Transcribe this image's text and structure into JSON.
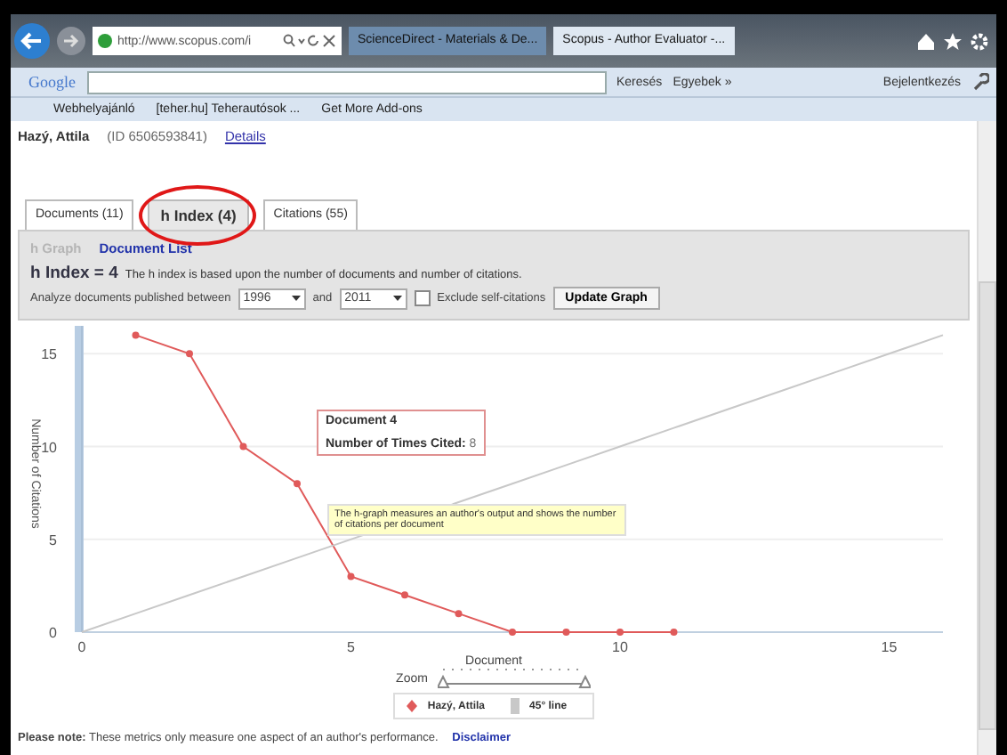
{
  "browser": {
    "address": "http://www.scopus.com/i",
    "tabs": [
      {
        "label": "ScienceDirect - Materials & De...",
        "selected": false
      },
      {
        "label": "Scopus - Author Evaluator -...",
        "selected": true
      }
    ],
    "toolbar": {
      "brand": "Google",
      "search_button": "Keresés",
      "more": "Egyebek »",
      "sign_in": "Bejelentkezés"
    },
    "favorites": [
      "Webhelyajánló",
      "[teher.hu] Teherautósok ...",
      "Get More Add-ons"
    ]
  },
  "author": {
    "name": "Hazý, Attila",
    "id": "(ID 6506593841)",
    "details_link": "Details"
  },
  "tabs": [
    {
      "label": "Documents (11)",
      "selected": false
    },
    {
      "label": "h Index (4)",
      "selected": true
    },
    {
      "label": "Citations (55)",
      "selected": false
    }
  ],
  "subtabs": [
    {
      "label": "h Graph",
      "selected": true
    },
    {
      "label": "Document List",
      "selected": false
    }
  ],
  "h_index": {
    "value": "h Index = 4",
    "description": "The h index is based upon the number of documents and number of citations."
  },
  "filter": {
    "label": "Analyze documents published between",
    "from": "1996",
    "and": "and",
    "to": "2011",
    "exclude_label": "Exclude self-citations",
    "exclude_checked": false,
    "button": "Update Graph"
  },
  "chart": {
    "chart_data": {
      "type": "line",
      "xlabel": "Document",
      "ylabel": "Number of Citations",
      "x": [
        0,
        1,
        2,
        3,
        4,
        5,
        6,
        7,
        8,
        9,
        10,
        11,
        12,
        13,
        14,
        15,
        16
      ],
      "series": [
        {
          "name": "Hazý, Attila",
          "color": "#e05a5a",
          "marker": "circle",
          "values": [
            null,
            16,
            15,
            10,
            8,
            3,
            2,
            1,
            0,
            0,
            0,
            0,
            null,
            null,
            null,
            null,
            null
          ]
        },
        {
          "name": "45° line",
          "color": "#c8c8c8",
          "values": [
            0,
            1,
            2,
            3,
            4,
            null,
            null,
            7,
            8,
            9,
            10,
            11,
            12,
            13,
            14,
            15,
            16
          ]
        }
      ],
      "xlim": [
        0,
        16
      ],
      "ylim": [
        0,
        16.5
      ],
      "xticks": [
        0,
        5,
        10,
        15
      ],
      "yticks": [
        0,
        5,
        10,
        15
      ],
      "grid": true,
      "legend": true
    },
    "point_tooltip": {
      "title": "Document 4",
      "label": "Number of Times Cited:",
      "value": "8"
    },
    "hint": "The h-graph measures an author's output and shows the number of citations per document",
    "zoom_label": "Zoom"
  },
  "note": {
    "label": "Please note:",
    "text": "These metrics only measure one aspect of an author's performance.",
    "link": "Disclaimer"
  }
}
